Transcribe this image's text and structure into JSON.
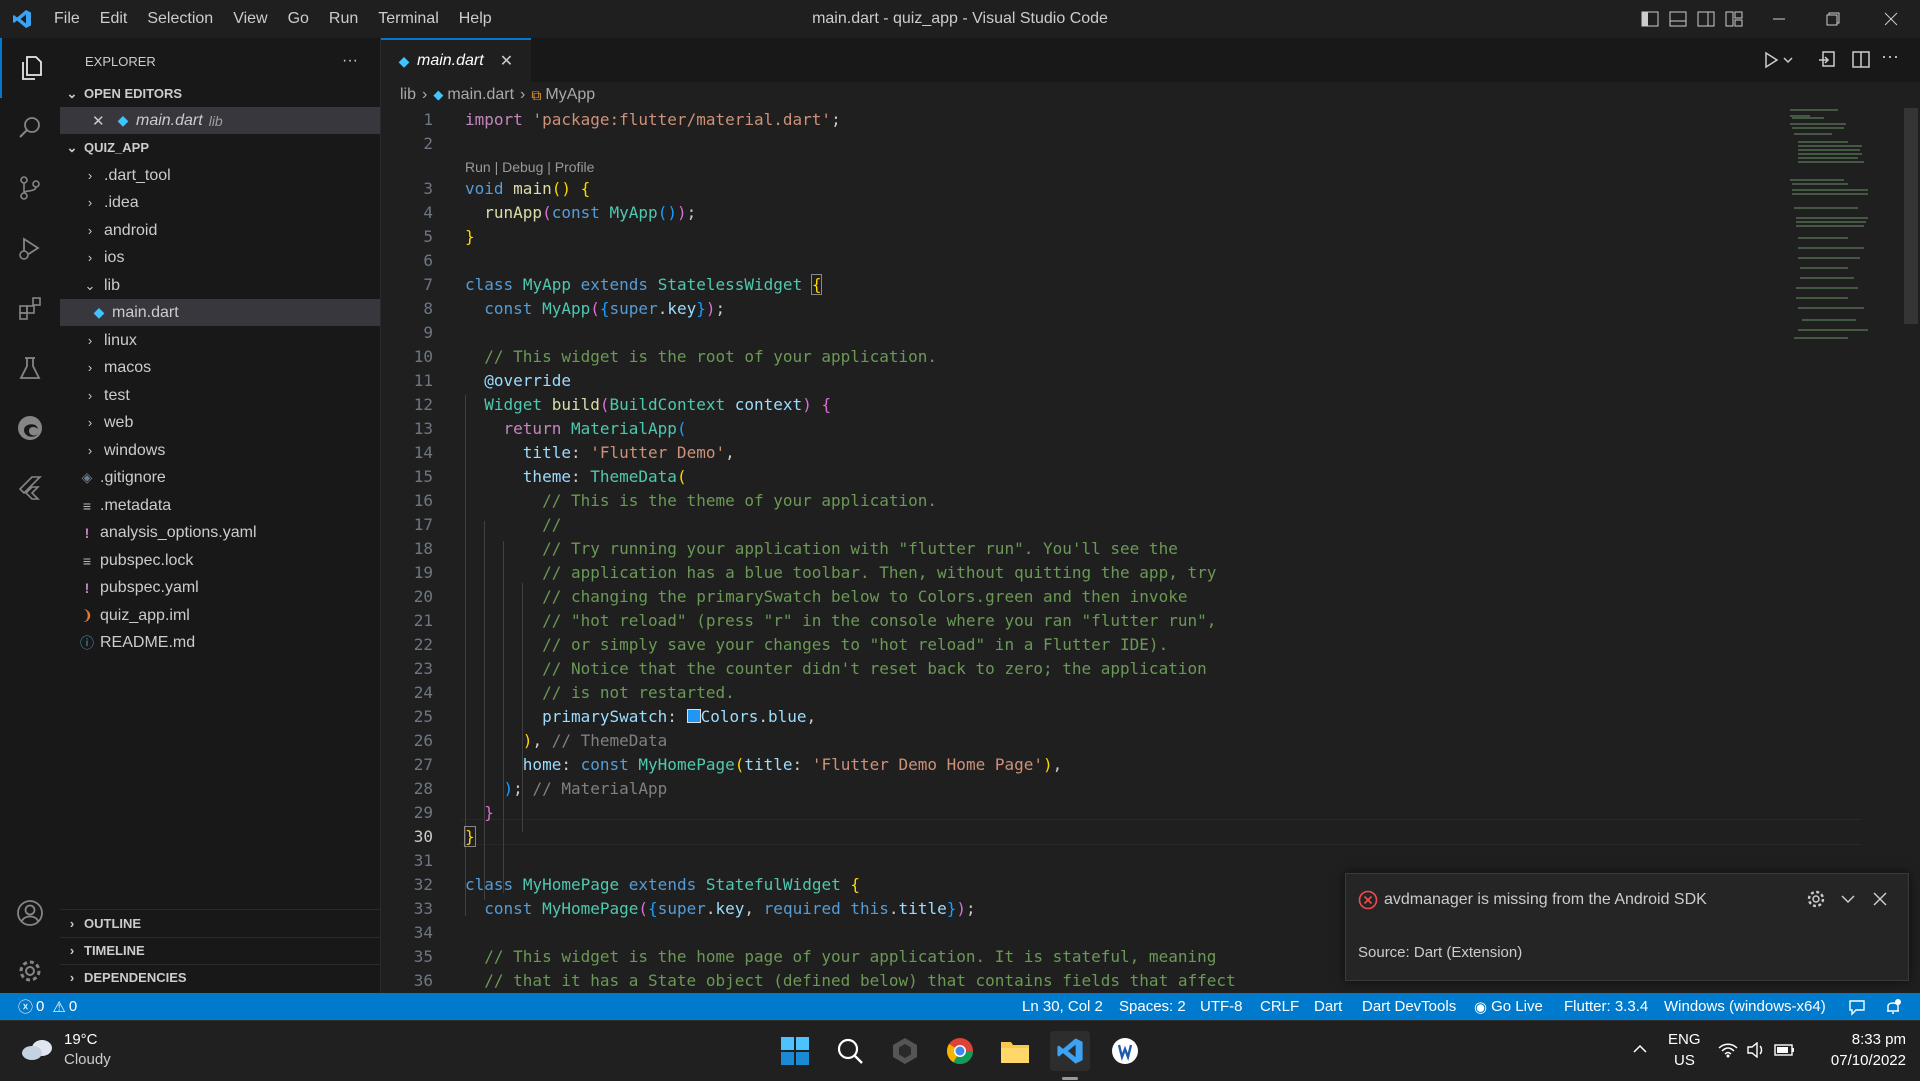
{
  "window": {
    "title": "main.dart - quiz_app - Visual Studio Code",
    "menu": [
      "File",
      "Edit",
      "Selection",
      "View",
      "Go",
      "Run",
      "Terminal",
      "Help"
    ]
  },
  "activity_bar": {
    "items": [
      "explorer-icon",
      "search-icon",
      "source-control-icon",
      "run-debug-icon",
      "extensions-icon",
      "testing-icon",
      "edge-devtools-icon",
      "flutter-icon"
    ],
    "bottom": [
      "account-icon",
      "manage-gear-icon"
    ]
  },
  "sidebar": {
    "title": "EXPLORER",
    "more": "···",
    "open_editors": {
      "label": "OPEN EDITORS",
      "file": "main.dart",
      "dir": "lib"
    },
    "project": {
      "label": "QUIZ_APP",
      "items": [
        {
          "name": ".dart_tool",
          "kind": "folder"
        },
        {
          "name": ".idea",
          "kind": "folder"
        },
        {
          "name": "android",
          "kind": "folder"
        },
        {
          "name": "ios",
          "kind": "folder"
        },
        {
          "name": "lib",
          "kind": "folder-open"
        },
        {
          "name": "main.dart",
          "kind": "dart"
        },
        {
          "name": "linux",
          "kind": "folder"
        },
        {
          "name": "macos",
          "kind": "folder"
        },
        {
          "name": "test",
          "kind": "folder"
        },
        {
          "name": "web",
          "kind": "folder"
        },
        {
          "name": "windows",
          "kind": "folder"
        },
        {
          "name": ".gitignore",
          "kind": "git"
        },
        {
          "name": ".metadata",
          "kind": "lines"
        },
        {
          "name": "analysis_options.yaml",
          "kind": "yaml"
        },
        {
          "name": "pubspec.lock",
          "kind": "lines"
        },
        {
          "name": "pubspec.yaml",
          "kind": "yaml"
        },
        {
          "name": "quiz_app.iml",
          "kind": "rss"
        },
        {
          "name": "README.md",
          "kind": "info"
        }
      ]
    },
    "sections": [
      "OUTLINE",
      "TIMELINE",
      "DEPENDENCIES"
    ]
  },
  "editor": {
    "tab_label": "main.dart",
    "breadcrumb": [
      "lib",
      "main.dart",
      "MyApp"
    ],
    "code_lens": "Run | Debug | Profile",
    "line_numbers": [
      "1",
      "2",
      "3",
      "4",
      "5",
      "6",
      "7",
      "8",
      "9",
      "10",
      "11",
      "12",
      "13",
      "14",
      "15",
      "16",
      "17",
      "18",
      "19",
      "20",
      "21",
      "22",
      "23",
      "24",
      "25",
      "26",
      "27",
      "28",
      "29",
      "30",
      "31",
      "32",
      "33",
      "34",
      "35",
      "36"
    ],
    "current_line": "30"
  },
  "notification": {
    "message": "avdmanager is missing from the Android SDK",
    "source": "Source: Dart (Extension)"
  },
  "status_bar": {
    "errors": "0",
    "warnings": "0",
    "position": "Ln 30, Col 2",
    "spaces": "Spaces: 2",
    "encoding": "UTF-8",
    "eol": "CRLF",
    "language": "Dart",
    "devtools": "Dart DevTools",
    "golive": "Go Live",
    "flutter": "Flutter: 3.3.4",
    "device": "Windows (windows-x64)"
  },
  "taskbar": {
    "weather_temp": "19°C",
    "weather_desc": "Cloudy",
    "lang1": "ENG",
    "lang2": "US",
    "time": "8:33 pm",
    "date": "07/10/2022"
  },
  "colors": {
    "accent": "#007acc",
    "error": "#f14c4c"
  }
}
